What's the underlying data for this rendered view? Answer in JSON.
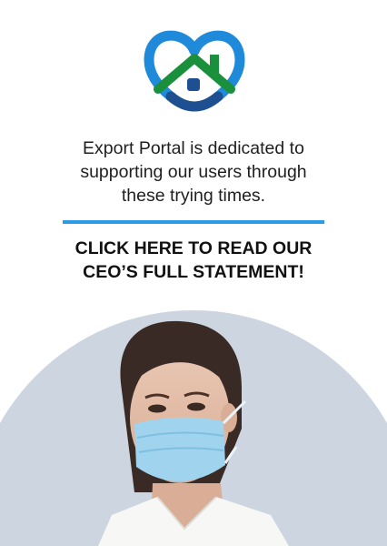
{
  "brand": {
    "logo_icon": "heart-house-icon",
    "colors": {
      "heart_blue": "#1f8ad9",
      "heart_navy": "#1d4f91",
      "roof_green": "#1a8f3c",
      "divider_blue": "#2c9ae6"
    }
  },
  "message": {
    "line1": "Export Portal is dedicated to",
    "line2": "supporting our users through",
    "line3": "these trying times."
  },
  "cta": {
    "line1": "CLICK HERE TO READ OUR",
    "line2": "CEO’S FULL STATEMENT!"
  },
  "photo": {
    "icon": "woman-wearing-face-mask-image"
  }
}
